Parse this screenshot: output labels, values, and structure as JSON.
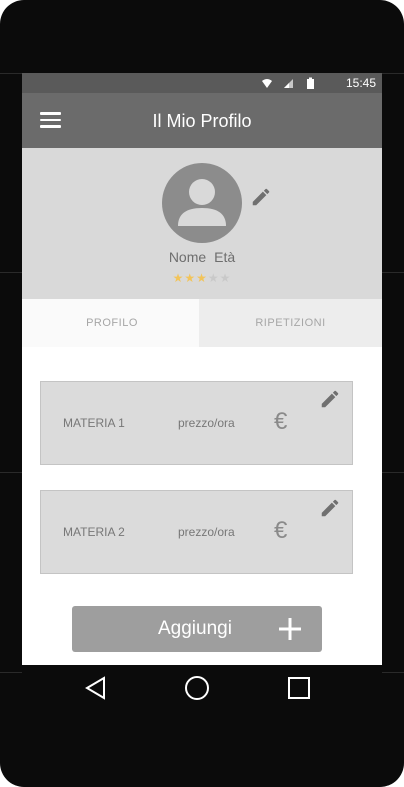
{
  "status_bar": {
    "time": "15:45"
  },
  "app_bar": {
    "title": "Il Mio Profilo"
  },
  "profile": {
    "name": "Nome",
    "age_label": "Età",
    "rating": 3,
    "rating_max": 5
  },
  "tabs": [
    {
      "label": "PROFILO",
      "selected": true
    },
    {
      "label": "RIPETIZIONI",
      "selected": false
    }
  ],
  "subjects": [
    {
      "subject": "MATERIA 1",
      "price_label": "prezzo/ora",
      "currency": "€"
    },
    {
      "subject": "MATERIA 2",
      "price_label": "prezzo/ora",
      "currency": "€"
    }
  ],
  "add_button": {
    "label": "Aggiungi"
  },
  "icons": {
    "menu": "menu-icon",
    "edit": "pencil-icon",
    "avatar": "person-icon",
    "add": "plus-icon",
    "back": "back-triangle-icon",
    "home": "home-circle-icon",
    "recents": "recents-square-icon",
    "wifi": "wifi-icon",
    "signal": "signal-icon",
    "battery": "battery-icon"
  },
  "colors": {
    "status_bar": "#5a5a5a",
    "app_bar": "#6b6b6b",
    "header_bg": "#d9d9d9",
    "star_filled": "#f2c45a",
    "star_empty": "#c9c9c9",
    "card_bg": "#dbdbdb",
    "add_button": "#9e9e9e"
  }
}
